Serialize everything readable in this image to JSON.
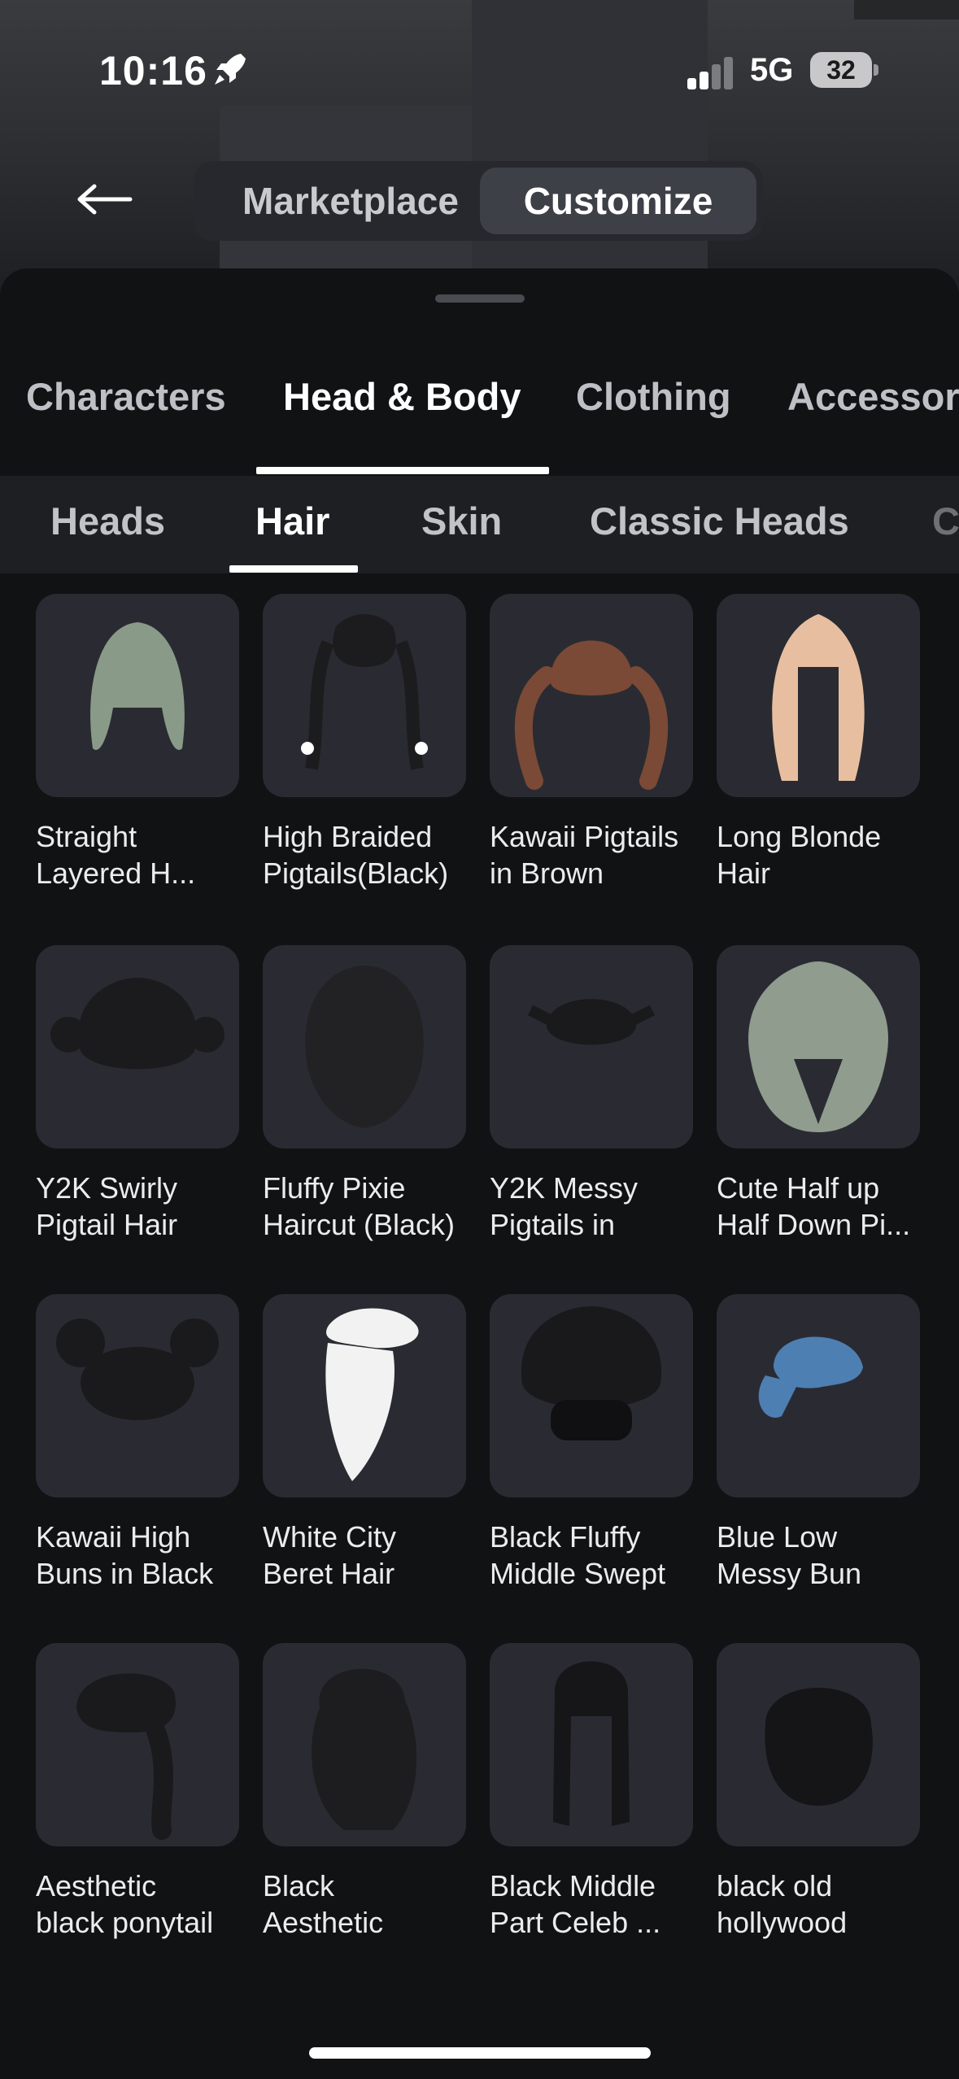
{
  "status_bar": {
    "time": "10:16",
    "network": "5G",
    "battery": "32"
  },
  "header": {
    "tabs": [
      {
        "label": "Marketplace"
      },
      {
        "label": "Customize"
      }
    ],
    "active_tab": "Customize"
  },
  "categories": [
    {
      "label": "Characters"
    },
    {
      "label": "Head & Body"
    },
    {
      "label": "Clothing"
    },
    {
      "label": "Accessor"
    }
  ],
  "active_category": "Head & Body",
  "sub_categories": [
    {
      "label": "Heads"
    },
    {
      "label": "Hair"
    },
    {
      "label": "Skin"
    },
    {
      "label": "Classic Heads"
    },
    {
      "label": "C"
    }
  ],
  "active_sub_category": "Hair",
  "items": [
    {
      "line1": "Straight",
      "line2": "Layered H...",
      "hair_color": "#8a9a88"
    },
    {
      "line1": "High Braided",
      "line2": "Pigtails(Black)",
      "hair_color": "#1c1c1e"
    },
    {
      "line1": "Kawaii Pigtails",
      "line2": "in Brown",
      "hair_color": "#7a4a36"
    },
    {
      "line1": "Long Blonde",
      "line2": "Hair",
      "hair_color": "#e7bfa0"
    },
    {
      "line1": "Y2K Swirly",
      "line2": "Pigtail Hair",
      "hair_color": "#1b1b1d"
    },
    {
      "line1": "Fluffy Pixie",
      "line2": "Haircut (Black)",
      "hair_color": "#222224"
    },
    {
      "line1": "Y2K Messy",
      "line2": "Pigtails in",
      "hair_color": "#1a1a1c"
    },
    {
      "line1": "Cute Half up",
      "line2": "Half Down Pi...",
      "hair_color": "#8f9c8e"
    },
    {
      "line1": "Kawaii High",
      "line2": "Buns in Black",
      "hair_color": "#1a1a1c"
    },
    {
      "line1": "White City",
      "line2": "Beret Hair",
      "hair_color": "#f2f2f2"
    },
    {
      "line1": "Black Fluffy",
      "line2": "Middle Swept",
      "hair_color": "#19191b"
    },
    {
      "line1": "Blue Low",
      "line2": "Messy Bun",
      "hair_color": "#4d7fb3"
    },
    {
      "line1": "Aesthetic",
      "line2": "black ponytail",
      "hair_color": "#1a1a1c"
    },
    {
      "line1": "Black",
      "line2": "Aesthetic",
      "hair_color": "#1d1d1f"
    },
    {
      "line1": "Black Middle",
      "line2": "Part Celeb ...",
      "hair_color": "#161618"
    },
    {
      "line1": "black old",
      "line2": "hollywood",
      "hair_color": "#151517"
    }
  ]
}
